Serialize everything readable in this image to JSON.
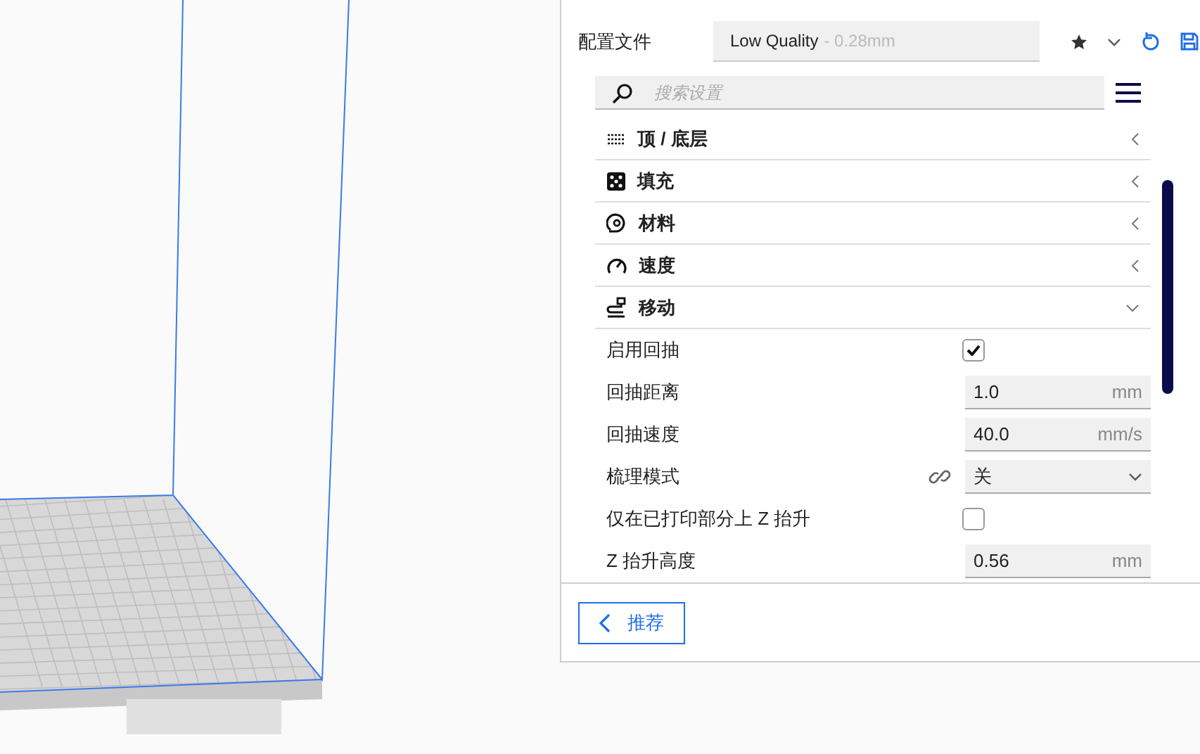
{
  "profile": {
    "label": "配置文件",
    "name": "Low Quality",
    "detail": "- 0.28mm"
  },
  "search": {
    "placeholder": "搜索设置"
  },
  "categories": [
    {
      "label": "顶 / 底层",
      "expanded": false
    },
    {
      "label": "填充",
      "expanded": false
    },
    {
      "label": "材料",
      "expanded": false
    },
    {
      "label": "速度",
      "expanded": false
    },
    {
      "label": "移动",
      "expanded": true
    }
  ],
  "settings": [
    {
      "kind": "checkbox",
      "label": "启用回抽",
      "checked": true
    },
    {
      "kind": "number",
      "label": "回抽距离",
      "value": "1.0",
      "unit": "mm"
    },
    {
      "kind": "number",
      "label": "回抽速度",
      "value": "40.0",
      "unit": "mm/s"
    },
    {
      "kind": "select",
      "label": "梳理模式",
      "value": "关",
      "linked": true
    },
    {
      "kind": "checkbox",
      "label": "仅在已打印部分上 Z 抬升",
      "checked": false
    },
    {
      "kind": "number",
      "label": "Z 抬升高度",
      "value": "0.56",
      "unit": "mm"
    }
  ],
  "footer": {
    "button": "推荐"
  }
}
